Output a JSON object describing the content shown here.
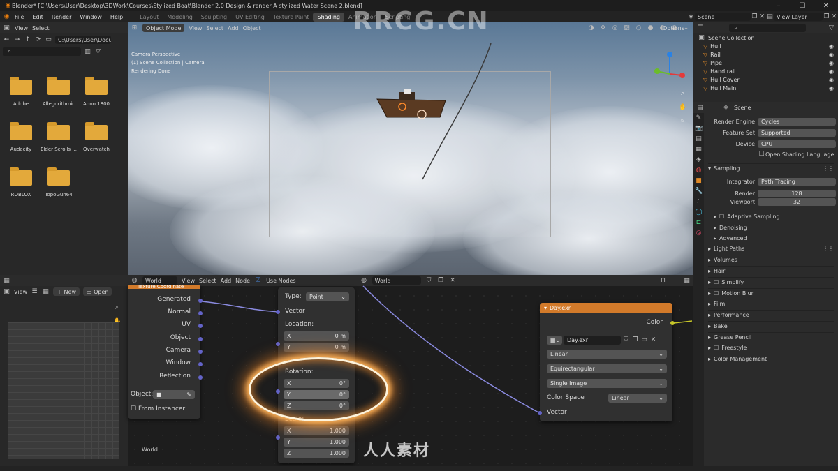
{
  "window": {
    "title": "Blender* [C:\\Users\\User\\Desktop\\3DWork\\Courses\\Stylized Boat\\Blender 2.0 Design & render A stylized Water Scene 2.blend]"
  },
  "menu": {
    "items": [
      "File",
      "Edit",
      "Render",
      "Window",
      "Help"
    ],
    "workspaces": [
      "Layout",
      "Modeling",
      "Sculpting",
      "UV Editing",
      "Texture Paint",
      "Shading",
      "Animation",
      "Scripting"
    ],
    "active_workspace": "Shading",
    "scene": "Scene",
    "view_layer": "View Layer"
  },
  "filebrowser": {
    "menus": [
      "View",
      "Select"
    ],
    "path": "C:\\Users\\User\\Docum...",
    "folders": [
      "Adobe",
      "Allegorithmic",
      "Anno 1800",
      "Audacity",
      "Elder Scrolls ...",
      "Overwatch",
      "ROBLOX",
      "TopoGun64"
    ]
  },
  "viewport": {
    "mode": "Object Mode",
    "menus": [
      "View",
      "Select",
      "Add",
      "Object"
    ],
    "info": [
      "Camera Perspective",
      "(1) Scene Collection | Camera",
      "Rendering Done"
    ],
    "options": "Options"
  },
  "outliner": {
    "root": "Scene Collection",
    "items": [
      "Hull",
      "Rail",
      "Pipe",
      "Hand rail",
      "Hull Cover",
      "Hull Main"
    ]
  },
  "properties": {
    "scene": "Scene",
    "rows": [
      {
        "label": "Render Engine",
        "value": "Cycles"
      },
      {
        "label": "Feature Set",
        "value": "Supported"
      },
      {
        "label": "Device",
        "value": "CPU"
      }
    ],
    "osl": "Open Shading Language",
    "sampling": {
      "title": "Sampling",
      "integrator_label": "Integrator",
      "integrator": "Path Tracing",
      "render_label": "Render",
      "render": "128",
      "viewport_label": "Viewport",
      "viewport": "32"
    },
    "subsections": [
      "Adaptive Sampling",
      "Denoising",
      "Advanced"
    ],
    "sections": [
      "Light Paths",
      "Volumes",
      "Hair",
      "Simplify",
      "Motion Blur",
      "Film",
      "Performance",
      "Bake",
      "Grease Pencil",
      "Freestyle",
      "Color Management"
    ]
  },
  "uveditor": {
    "view": "View",
    "new": "New",
    "open": "Open"
  },
  "nodeeditor": {
    "world_type": "World",
    "menus": [
      "View",
      "Select",
      "Add",
      "Node"
    ],
    "use_nodes": "Use Nodes",
    "world_name": "World",
    "breadcrumb": "World"
  },
  "texcoord": {
    "title": "Texture Coordinate",
    "outputs": [
      "Generated",
      "Normal",
      "UV",
      "Object",
      "Camera",
      "Window",
      "Reflection"
    ],
    "object_label": "Object:",
    "from_instancer": "From Instancer"
  },
  "mapping": {
    "type_label": "Type:",
    "type": "Point",
    "vector": "Vector",
    "location": "Location:",
    "rotation": "Rotation:",
    "scale": "Scale:",
    "loc": [
      {
        "axis": "X",
        "value": "0 m"
      },
      {
        "axis": "Y",
        "value": "0 m"
      }
    ],
    "rot": [
      {
        "axis": "X",
        "value": "0°"
      },
      {
        "axis": "Y",
        "value": "0°"
      },
      {
        "axis": "Z",
        "value": "0°"
      }
    ],
    "scl": [
      {
        "axis": "X",
        "value": "1.000"
      },
      {
        "axis": "Y",
        "value": "1.000"
      },
      {
        "axis": "Z",
        "value": "1.000"
      }
    ]
  },
  "envtex": {
    "title": "Day.exr",
    "color": "Color",
    "image": "Day.exr",
    "interp": "Linear",
    "proj": "Equirectangular",
    "source": "Single Image",
    "cs_label": "Color Space",
    "cs": "Linear",
    "vector": "Vector"
  },
  "watermarks": {
    "top": "RRCG.CN",
    "bottom": "人人素材"
  },
  "colors": {
    "accent": "#e08a27",
    "node_header_orange": "#d27a2a",
    "socket_purple": "#6363c7",
    "socket_yellow": "#c7c729",
    "selected_ws": "#464646"
  }
}
